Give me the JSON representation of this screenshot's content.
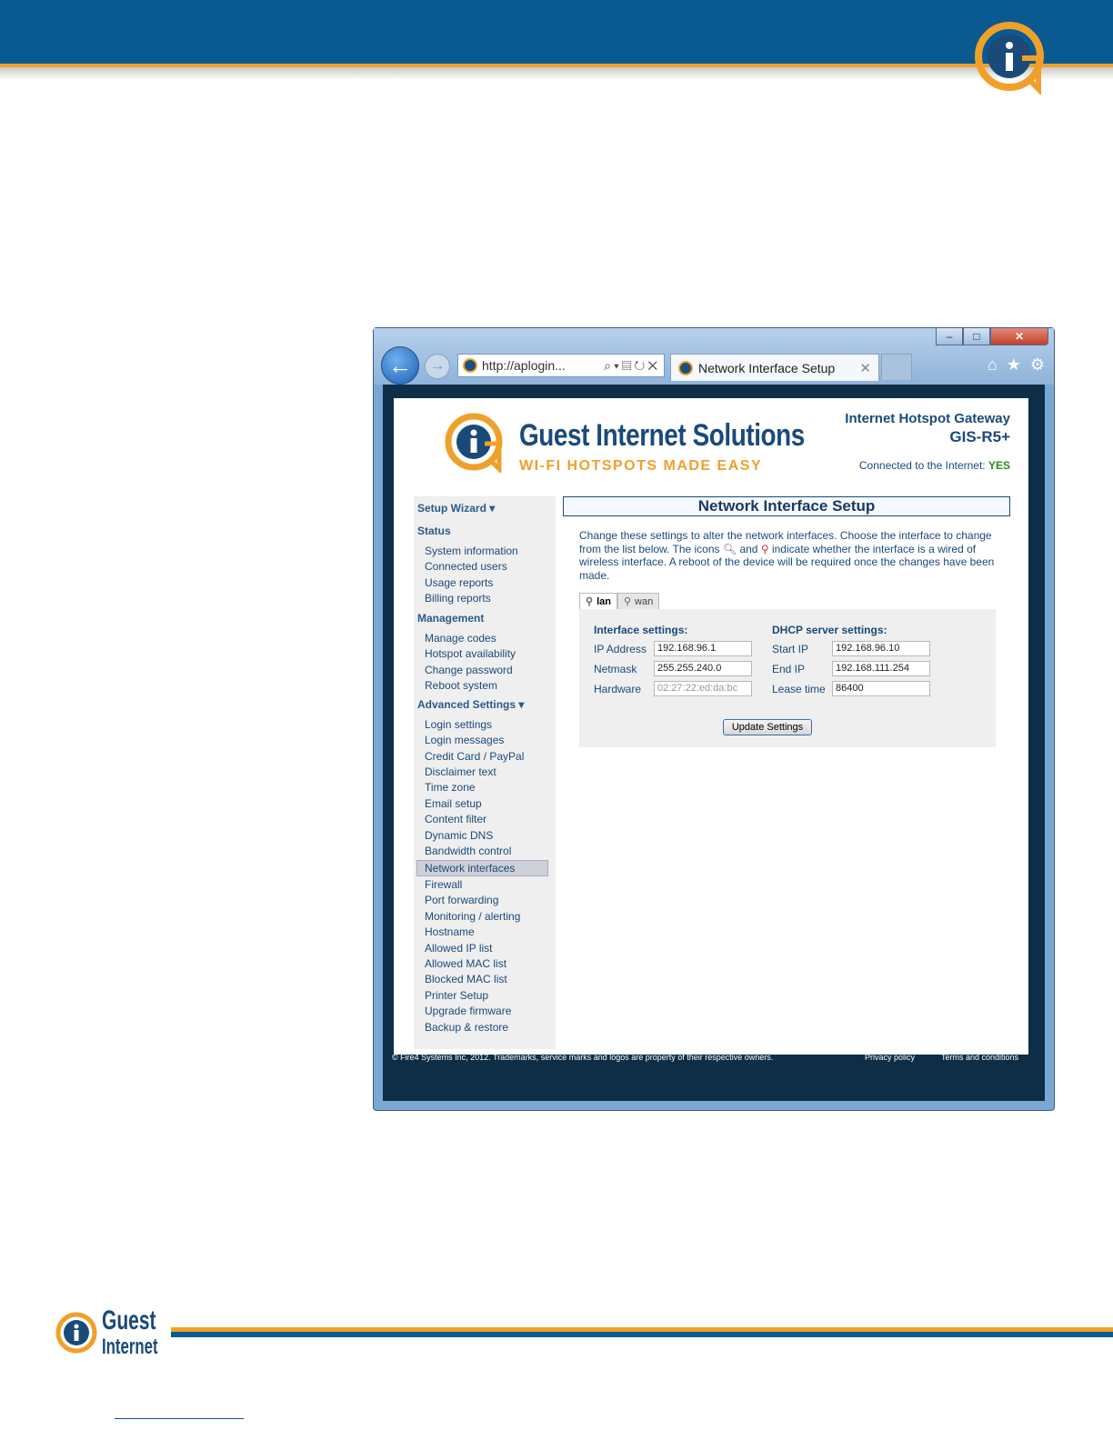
{
  "colors": {
    "brand_blue": "#0a5a92",
    "brand_orange": "#f0a02a",
    "link_blue": "#1a4a7a",
    "yes_green": "#2a8a20"
  },
  "browser": {
    "address": "http://aplogin...",
    "tab_title": "Network Interface Setup",
    "back_icon": "arrow-left-icon",
    "forward_icon": "arrow-right-icon"
  },
  "header": {
    "logo_name": "Guest Internet Solutions",
    "logo_tagline": "WI-FI HOTSPOTS MADE EASY",
    "gateway_title": "Internet Hotspot Gateway",
    "gateway_model": "GIS-R5+",
    "connected_label": "Connected to the Internet:",
    "connected_value": "YES"
  },
  "sidebar": {
    "setup_wizard": "Setup Wizard",
    "status": "Status",
    "status_items": [
      "System information",
      "Connected users",
      "Usage reports",
      "Billing reports"
    ],
    "management": "Management",
    "management_items": [
      "Manage codes",
      "Hotspot availability",
      "Change password",
      "Reboot system"
    ],
    "advanced": "Advanced Settings",
    "advanced_items": [
      "Login settings",
      "Login messages",
      "Credit Card / PayPal",
      "Disclaimer text",
      "Time zone",
      "Email setup",
      "Content filter",
      "Dynamic DNS",
      "Bandwidth control",
      "Network interfaces",
      "Firewall",
      "Port forwarding",
      "Monitoring / alerting",
      "Hostname",
      "Allowed IP list",
      "Allowed MAC list",
      "Blocked MAC list",
      "Printer Setup",
      "Upgrade firmware",
      "Backup & restore"
    ],
    "active_item": "Network interfaces"
  },
  "main": {
    "title": "Network Interface Setup",
    "description_1": "Change these settings to alter the network interfaces. Choose the interface to change from the list below. The icons",
    "description_and": "and",
    "description_2": "indicate whether the interface is a wired of wireless interface. A reboot of the device will be required once the changes have been made.",
    "tabs": [
      "lan",
      "wan"
    ],
    "interface_heading": "Interface settings:",
    "dhcp_heading": "DHCP server settings:",
    "ip_label": "IP Address",
    "ip_value": "192.168.96.1",
    "netmask_label": "Netmask",
    "netmask_value": "255.255.240.0",
    "hardware_label": "Hardware",
    "hardware_value": "02:27:22:ed:da:bc",
    "start_ip_label": "Start IP",
    "start_ip_value": "192.168.96.10",
    "end_ip_label": "End IP",
    "end_ip_value": "192.168.111.254",
    "lease_label": "Lease time",
    "lease_value": "86400",
    "update_button": "Update Settings"
  },
  "footer": {
    "copyright": "© Fire4 Systems Inc, 2012. Trademarks, service marks and logos are property of their respective owners.",
    "privacy": "Privacy policy",
    "terms": "Terms and conditions"
  },
  "doc_footer": {
    "logo_line1": "Guest",
    "logo_line2": "Internet"
  }
}
